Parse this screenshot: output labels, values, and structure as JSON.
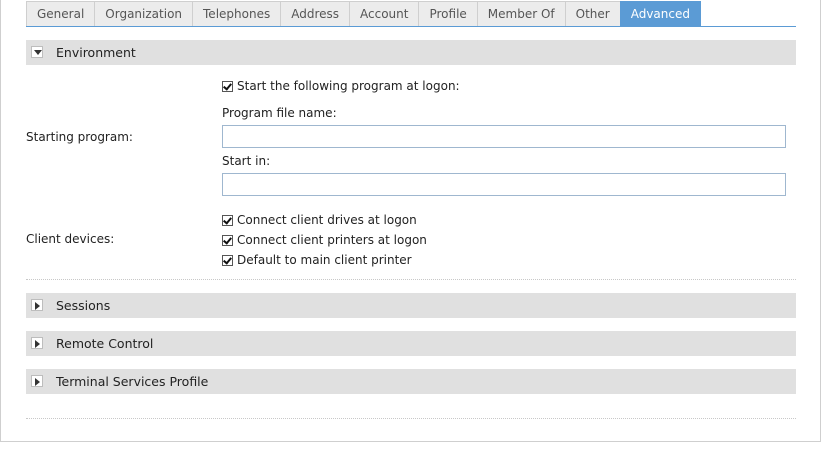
{
  "tabs": [
    {
      "label": "General"
    },
    {
      "label": "Organization"
    },
    {
      "label": "Telephones"
    },
    {
      "label": "Address"
    },
    {
      "label": "Account"
    },
    {
      "label": "Profile"
    },
    {
      "label": "Member Of"
    },
    {
      "label": "Other"
    },
    {
      "label": "Advanced",
      "active": true
    }
  ],
  "environment": {
    "title": "Environment",
    "starting_program_label": "Starting program:",
    "start_program_checkbox": {
      "label": "Start the following program at logon:",
      "checked": true
    },
    "program_file_label": "Program file name:",
    "program_file_value": "",
    "start_in_label": "Start in:",
    "start_in_value": "",
    "client_devices_label": "Client devices:",
    "client_devices": [
      {
        "label": "Connect client drives at logon",
        "checked": true
      },
      {
        "label": "Connect client printers at logon",
        "checked": true
      },
      {
        "label": "Default to main client printer",
        "checked": true
      }
    ]
  },
  "sections": {
    "sessions": "Sessions",
    "remote_control": "Remote Control",
    "ts_profile": "Terminal Services Profile"
  },
  "colors": {
    "accent": "#5b9bd5",
    "section_bg": "#e0e0e0",
    "tab_bg": "#ececec"
  }
}
